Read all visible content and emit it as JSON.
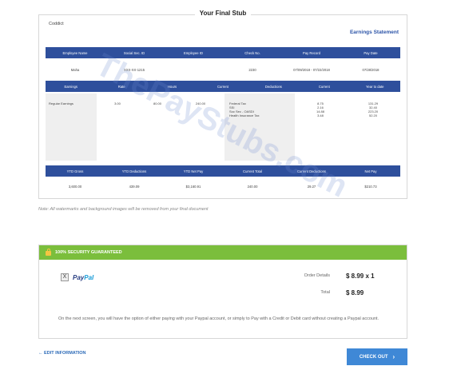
{
  "stub": {
    "title": "Your Final Stub",
    "company": "Coddict",
    "statement_label": "Earnings Statement",
    "employee_headers": [
      "Employee Name",
      "Social Sec. ID",
      "Employee ID",
      "Check No.",
      "Pay Record",
      "Pay Date"
    ],
    "employee_row": [
      "Maha",
      "XXX-XX-1215",
      "",
      "2230",
      "07/09/2018 - 07/22/2018",
      "07/28/2018"
    ],
    "earnings_headers": [
      "Earnings",
      "Rate",
      "Hours",
      "Current",
      "Deductions",
      "Current",
      "Year to date"
    ],
    "earnings_row": {
      "label": "Regular Earnings",
      "rate": "3.00",
      "hours": "80.00",
      "current": "240.00"
    },
    "deductions": [
      {
        "label": "Federal Tax",
        "current": "8.75",
        "ytd": "131.29"
      },
      {
        "label": "SSI",
        "current": "2.16",
        "ytd": "32.40"
      },
      {
        "label": "Soc Sec - OASDI",
        "current": "14.88",
        "ytd": "223.20"
      },
      {
        "label": "Health Insurance Tax",
        "current": "3.48",
        "ytd": "52.20"
      }
    ],
    "totals_headers": [
      "YTD Gross",
      "YTD Deductions",
      "YTD Net Pay",
      "Current Total",
      "Current Deductions",
      "Net Pay"
    ],
    "totals_row": [
      "3,600.00",
      "439.09",
      "$3,160.91",
      "240.00",
      "29.27",
      "$210.73"
    ],
    "watermark": "ThePayStubs.com"
  },
  "note": "Note: All watermarks and background images will be removed from your final document",
  "security": {
    "header": "100% SECURITY GUARANTEED",
    "payment_method_mark": "X",
    "paypal_pay": "Pay",
    "paypal_pal": "Pal",
    "order_details_label": "Order Details",
    "order_details_value": "$ 8.99 x 1",
    "total_label": "Total",
    "total_value": "$ 8.99",
    "info": "On the next screen, you will have the option of either paying with your Paypal account, or simply to Pay with a Credit or Debit card without creating a Paypal account."
  },
  "nav": {
    "edit_label": "EDIT INFORMATION",
    "checkout_label": "CHECK OUT"
  },
  "colors": {
    "bar_blue": "#2e4f9c",
    "security_green": "#7bbe3c",
    "checkout_blue": "#3f88d6"
  }
}
